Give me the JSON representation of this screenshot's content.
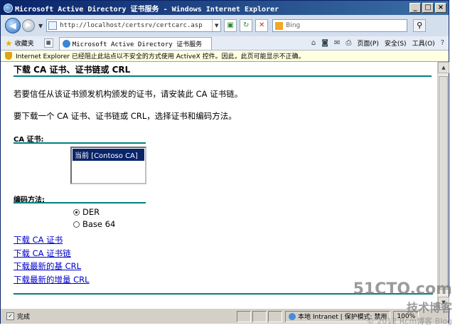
{
  "window": {
    "title": "Microsoft Active Directory 证书服务 - Windows Internet Explorer",
    "buttons": {
      "minimize": "_",
      "maximize": "□",
      "close": "×"
    }
  },
  "toolbar": {
    "address": "http://localhost/certsrv/certcarc.asp",
    "search_placeholder": "Bing"
  },
  "command_bar": {
    "favorites": "收藏夹",
    "tab_title": "Microsoft Active Directory 证书服务",
    "page_menu": "页面(P)",
    "safety_menu": "安全(S)",
    "tools_menu": "工具(O)"
  },
  "infobar": {
    "message": "Internet Explorer 已经阻止此站点以不安全的方式使用 ActiveX 控件。因此，此页可能显示不正确。"
  },
  "page": {
    "title": "下载 CA 证书、证书链或 CRL",
    "para1": "若要信任从该证书颁发机构颁发的证书，请安装此 CA 证书链。",
    "para2": "要下载一个 CA 证书、证书链或 CRL，选择证书和编码方法。",
    "ca_label": "CA 证书:",
    "ca_options": [
      "当前 [Contoso CA]"
    ],
    "encoding_label": "编码方法:",
    "encoding_options": [
      {
        "label": "DER",
        "checked": true
      },
      {
        "label": "Base 64",
        "checked": false
      }
    ],
    "links": [
      "下载 CA 证书",
      "下载 CA 证书链",
      "下载最新的基 CRL",
      "下载最新的增量 CRL"
    ]
  },
  "statusbar": {
    "status": "完成",
    "zone": "本地 Intranet | 保护模式: 禁用",
    "zoom": "100%"
  },
  "watermark": {
    "site": "51CTO.com",
    "text": "技术博客",
    "footer": "© 2012 Rcm博客 Blog"
  }
}
